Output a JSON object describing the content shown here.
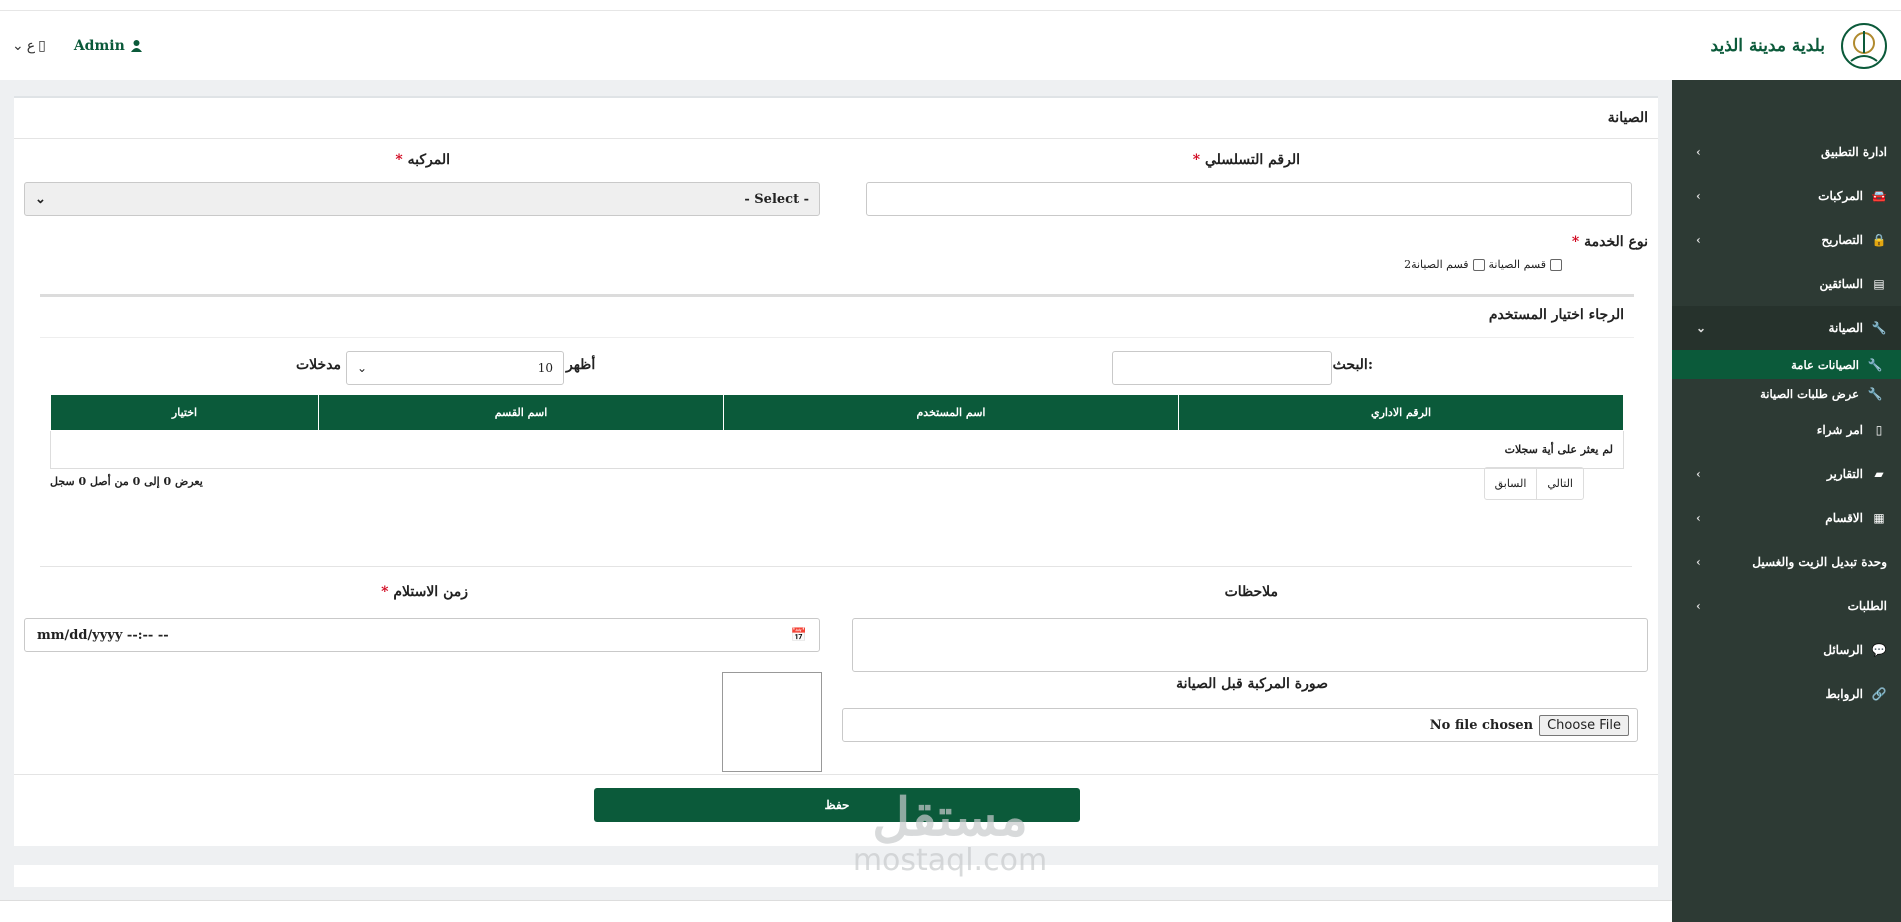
{
  "header": {
    "app_name": "بلدية مدينة الذيد",
    "user": "Admin",
    "lang": "ع"
  },
  "sidebar": {
    "items": [
      {
        "label": "ادارة التطبيق",
        "icon": "none"
      },
      {
        "label": "المركبات",
        "icon": "car-icon"
      },
      {
        "label": "التصاريح",
        "icon": "lock-icon"
      },
      {
        "label": "السائقين",
        "icon": "id-card-icon"
      },
      {
        "label": "الصيانة",
        "icon": "wrench-icon"
      },
      {
        "label": "الصيانات عامة",
        "icon": "wrench-icon"
      },
      {
        "label": "عرض طلبات الصيانة",
        "icon": "wrench-icon"
      },
      {
        "label": "امر شراء",
        "icon": "file-icon"
      },
      {
        "label": "التقارير",
        "icon": "book-icon"
      },
      {
        "label": "الاقسام",
        "icon": "building-icon"
      },
      {
        "label": "وحدة تبديل الزيت والغسيل",
        "icon": "none"
      },
      {
        "label": "الطلبات",
        "icon": "none"
      },
      {
        "label": "الرسائل",
        "icon": "chat-icon"
      },
      {
        "label": "الروابط",
        "icon": "link-icon"
      }
    ]
  },
  "form": {
    "title": "الصيانة",
    "serial_label": "الرقم التسلسلي",
    "vehicle_label": "المركبه",
    "vehicle_value": "- Select -",
    "service_type_label": "نوع الخدمة",
    "service_options": [
      "قسم الصيانة",
      "قسم الصيانة2"
    ],
    "required_mark": "*",
    "users_panel": {
      "title": "الرجاء اختيار المستخدم",
      "search_label": "البحث:",
      "show_label": "أظهر",
      "show_value": "10",
      "entries_label": "مدخلات",
      "columns": [
        "الرقم الاداري",
        "اسم المستخدم",
        "اسم القسم",
        "اختيار"
      ],
      "empty_text": "لم يعثر على أية سجلات",
      "info_text": "يعرض 0 إلى 0 من أصل 0 سجل",
      "prev": "السابق",
      "next": "التالي"
    },
    "notes_label": "ملاحظات",
    "receive_time_label": "زمن الاستلام",
    "date_placeholder": "mm/dd/yyyy --:-- --",
    "photo_label": "صورة المركبة قبل الصيانة",
    "file_button": "Choose File",
    "file_status": "No file chosen",
    "save_label": "حفظ"
  },
  "watermark": {
    "arabic": "مستقل",
    "latin": "mostaql.com"
  },
  "colors": {
    "primary": "#0b5a3a",
    "sidebar": "#2d3a34",
    "required": "#d0021b"
  }
}
